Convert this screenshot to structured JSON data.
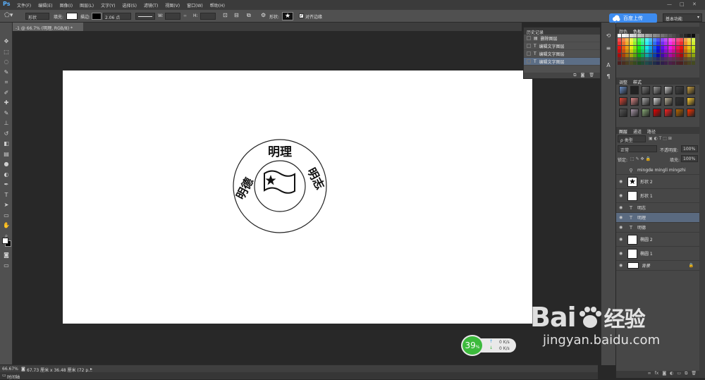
{
  "app": {
    "logo": "Ps"
  },
  "menu": [
    "文件(F)",
    "编辑(E)",
    "图像(I)",
    "图层(L)",
    "文字(Y)",
    "选择(S)",
    "滤镜(T)",
    "视图(V)",
    "窗口(W)",
    "帮助(H)"
  ],
  "window_controls": [
    "—",
    "□",
    "✕"
  ],
  "options": {
    "mode": "形状",
    "fill_label": "填充:",
    "stroke_label": "描边:",
    "stroke_width": "2.06 点",
    "w_label": "W:",
    "h_label": "H:",
    "shape_label": "形状:",
    "align_edges": "对齐边缘"
  },
  "upload_button": "百度上传",
  "workspace": "基本功能",
  "document_tab": "-1 @ 66.7% (明理, RGB/8) *",
  "canvas": {
    "top_text": "明理",
    "left_text": "明德",
    "right_text": "明志"
  },
  "status": {
    "zoom": "66.67%",
    "doc_size": "67.73 厘米 x 36.48 厘米 (72 p...",
    "timeline": "时间轴"
  },
  "history": {
    "title": "历史记录",
    "items": [
      {
        "label": "删除图层",
        "active": false
      },
      {
        "label": "编辑文字图层",
        "active": false
      },
      {
        "label": "编辑文字图层",
        "active": false
      },
      {
        "label": "编辑文字图层",
        "active": true
      }
    ]
  },
  "swatches": {
    "tabs": [
      "颜色",
      "色板"
    ]
  },
  "styles": {
    "tabs": [
      "调整",
      "样式"
    ]
  },
  "layers": {
    "tabs": [
      "图层",
      "通道",
      "路径"
    ],
    "kind": "ρ 类型",
    "blend": "正常",
    "opacity_label": "不透明度:",
    "opacity": "100%",
    "lock_label": "锁定:",
    "fill_label": "填充:",
    "fill": "100%",
    "items": [
      {
        "name": "mingde mingli mingzhi",
        "kind": "group",
        "selected": false
      },
      {
        "name": "形状 2",
        "kind": "star",
        "selected": false
      },
      {
        "name": "形状 1",
        "kind": "shape",
        "selected": false
      },
      {
        "name": "明志",
        "kind": "text",
        "selected": false
      },
      {
        "name": "明理",
        "kind": "text",
        "selected": true
      },
      {
        "name": "明德",
        "kind": "text",
        "selected": false
      },
      {
        "name": "椭圆 2",
        "kind": "ellipse",
        "selected": false
      },
      {
        "name": "椭圆 1",
        "kind": "ellipse",
        "selected": false
      },
      {
        "name": "背景",
        "kind": "bg",
        "selected": false
      }
    ]
  },
  "network": {
    "percent": "39",
    "percent_unit": "%",
    "up": "0 K/s",
    "down": "0 K/s"
  },
  "watermark": {
    "brand": "Bai",
    "brand2": "经验",
    "url": "jingyan.baidu.com"
  }
}
